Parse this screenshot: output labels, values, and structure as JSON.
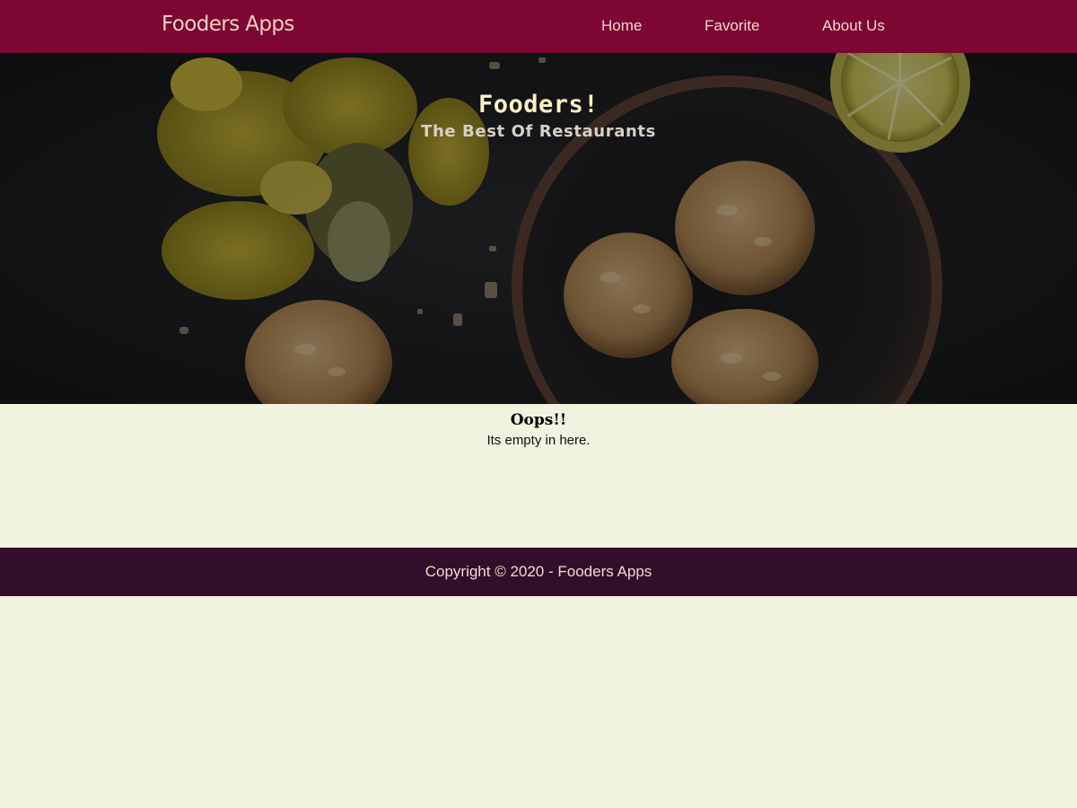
{
  "header": {
    "brand": "Fooders Apps",
    "nav": [
      {
        "label": "Home"
      },
      {
        "label": "Favorite"
      },
      {
        "label": "About Us"
      }
    ]
  },
  "hero": {
    "title": "Fooders!",
    "subtitle": "The Best Of Restaurants"
  },
  "favorites": {
    "empty_title": "Oops!!",
    "empty_message": "Its empty in here."
  },
  "footer": {
    "copyright": "Copyright © 2020 - Fooders Apps"
  },
  "colors": {
    "header_bg": "#7d0633",
    "footer_bg": "#330e2b",
    "page_bg": "#f1f2df",
    "nav_text": "#f6d8ce",
    "hero_title": "#fdf1c2"
  }
}
